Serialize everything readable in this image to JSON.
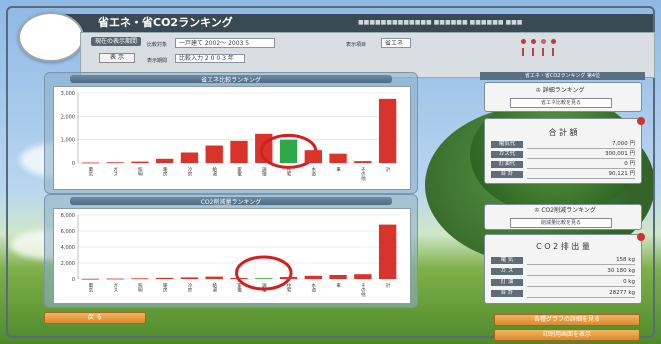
{
  "header": {
    "title": "省エネ・省CO2ランキング",
    "subtitle": "■■■■■■■■■■■■■ ■■■■■■ ■■■■■■ ■■■",
    "btn_change": "現在の表示期間",
    "btn_select": "表 示",
    "field_period": "一戸建て 2002～ 2003 5",
    "field_compare": "比較入力 2 0 0 3 年",
    "field_user": "省エネ",
    "lbl_period": "比較対象",
    "lbl_compare": "表示期間",
    "lbl_mode": "表示項目"
  },
  "colors": {
    "bar_red": "#d9342b",
    "bar_green": "#2fa84a",
    "circle": "#d21f1f"
  },
  "chart1": {
    "title": "省エネ比較ランキング",
    "chart_data": {
      "type": "bar",
      "ylim": [
        0,
        3000
      ],
      "yticks": [
        "3,000",
        "2,000",
        "1,000",
        "0"
      ],
      "values": [
        20,
        30,
        60,
        180,
        450,
        750,
        950,
        1250,
        1000,
        550,
        400,
        80,
        2750
      ],
      "highlight_index": 8,
      "categories": [
        "電気",
        "ガス",
        "照明",
        "暖房",
        "冷房",
        "給湯",
        "家電",
        "調理",
        "住宅",
        "水道",
        "車",
        "その他",
        "計"
      ]
    }
  },
  "chart2": {
    "title": "CO2削減量ランキング",
    "chart_data": {
      "type": "bar",
      "ylim": [
        0,
        8000
      ],
      "yticks": [
        "8,000",
        "6,000",
        "4,000",
        "2,000",
        "0"
      ],
      "values": [
        30,
        50,
        80,
        150,
        200,
        300,
        120,
        100,
        250,
        400,
        500,
        600,
        6800
      ],
      "highlight_index": 7,
      "categories": [
        "電気",
        "ガス",
        "照明",
        "暖房",
        "冷房",
        "給湯",
        "家電",
        "調理",
        "住宅",
        "水道",
        "車",
        "その他",
        "計"
      ]
    }
  },
  "right": {
    "top_header": "省エネ・省CO2ランキング 第4位",
    "btn_detail": "詳細ランキング",
    "btn_detail2": "省エネ比較を見る",
    "summary_title": "合 計 額",
    "summary_rows": [
      {
        "k": "電気代",
        "v": "7,000 円"
      },
      {
        "k": "ガス代",
        "v": "300,001 円"
      },
      {
        "k": "灯油代",
        "v": "0 円"
      },
      {
        "k": "合 計",
        "v": "90,121 円"
      }
    ],
    "btn_ranking": "CO2削減ランキング",
    "btn_ranking2": "削減量比較を見る",
    "co2_title": "C O 2 排 出 量",
    "co2_rows": [
      {
        "k": "電 気",
        "v": "158 kg"
      },
      {
        "k": "ガ ス",
        "v": "30 180 kg"
      },
      {
        "k": "灯 油",
        "v": "0 kg"
      },
      {
        "k": "合 計",
        "v": "28277 kg"
      }
    ]
  },
  "footer": {
    "btn_back": "戻 る",
    "btn_next": "各種グラフの詳細を見る",
    "btn_print": "印刷用画面を表示"
  }
}
